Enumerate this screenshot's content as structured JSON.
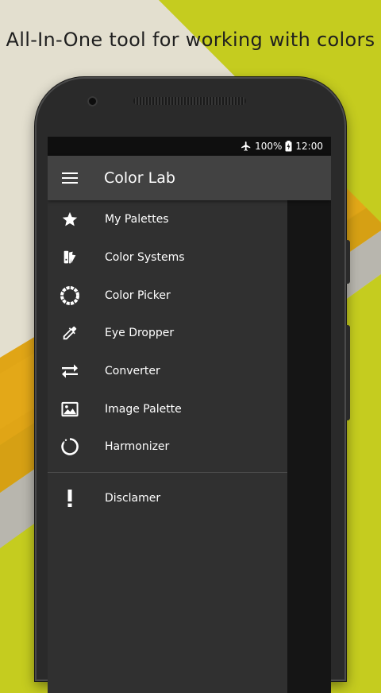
{
  "headline": "All-In-One tool for working with colors",
  "status": {
    "airplane_icon": "airplane-icon",
    "battery_text": "100%",
    "battery_icon": "battery-charging-icon",
    "time": "12:00"
  },
  "toolbar": {
    "menu_icon": "hamburger-menu-icon",
    "title": "Color Lab"
  },
  "drawer": {
    "items": [
      {
        "label": "My Palettes",
        "icon": "star-icon"
      },
      {
        "label": "Color Systems",
        "icon": "color-fan-icon"
      },
      {
        "label": "Color Picker",
        "icon": "color-wheel-icon"
      },
      {
        "label": "Eye Dropper",
        "icon": "eyedropper-icon"
      },
      {
        "label": "Converter",
        "icon": "swap-arrows-icon"
      },
      {
        "label": "Image Palette",
        "icon": "image-icon"
      },
      {
        "label": "Harmonizer",
        "icon": "harmonizer-ring-icon"
      }
    ],
    "secondary_items": [
      {
        "label": "Disclamer",
        "icon": "exclamation-icon"
      }
    ]
  },
  "colors": {
    "background_lime": "#c5cc1f",
    "background_cream": "#e3dfcf",
    "background_orange": "#e0a516",
    "background_gray": "#b5b3ad",
    "phone_body": "#2a2a2a",
    "toolbar": "#424242",
    "drawer": "#303030",
    "text": "#ffffff"
  }
}
